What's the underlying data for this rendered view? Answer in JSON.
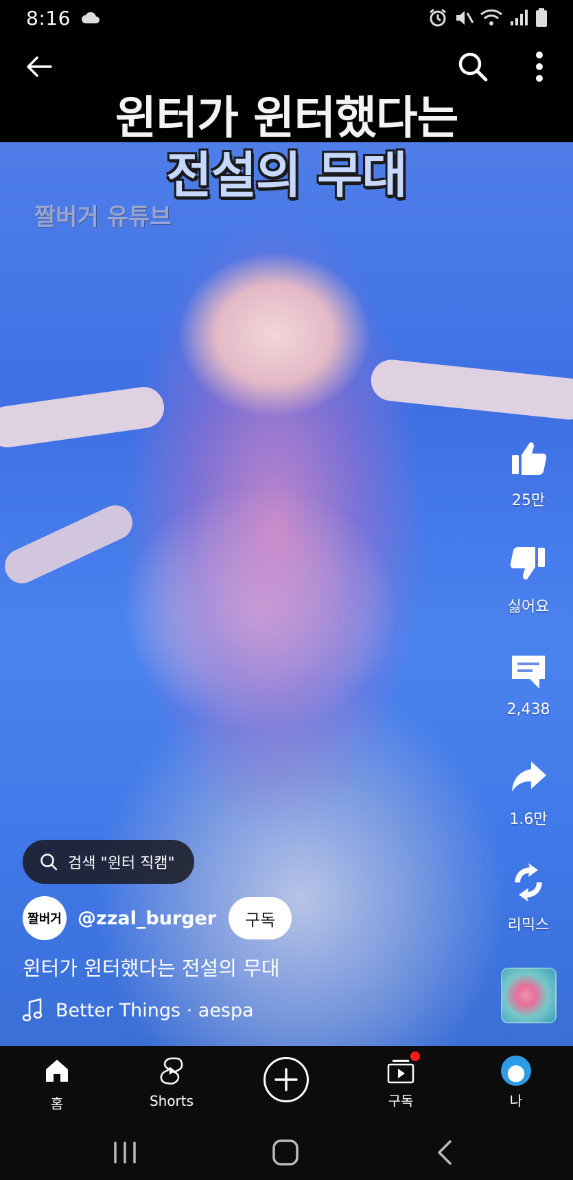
{
  "status_bar": {
    "time": "8:16"
  },
  "header": {
    "back_label": "back",
    "search_label": "search",
    "more_label": "more"
  },
  "video": {
    "title_line1": "윈터가 윈터했다는",
    "title_line2": "전설의 무대",
    "watermark": "짤버거 유튜브"
  },
  "actions": {
    "like_count": "25만",
    "dislike_label": "싫어요",
    "comment_count": "2,438",
    "share_count": "1.6만",
    "remix_label": "리믹스"
  },
  "search_suggestion": {
    "text": "검색 \"윈터 직캠\""
  },
  "channel": {
    "avatar_text": "짤버거",
    "handle": "@zzal_burger",
    "subscribe_label": "구독"
  },
  "caption": "윈터가 윈터했다는 전설의 무대",
  "music": {
    "text": "Better Things · aespa"
  },
  "bottom_nav": {
    "home": "홈",
    "shorts": "Shorts",
    "subscriptions": "구독",
    "me": "나"
  },
  "colors": {
    "accent_red": "#ff1b1b",
    "background": "#000000"
  }
}
